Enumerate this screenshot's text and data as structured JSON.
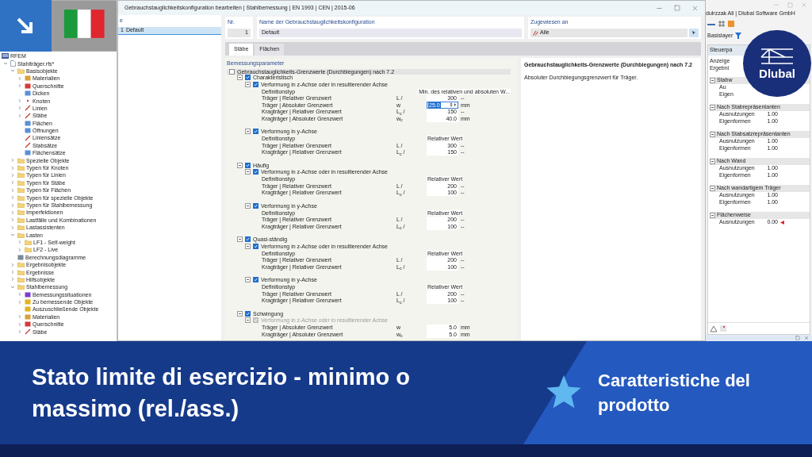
{
  "navigator": {
    "title": "RFEM",
    "items": [
      {
        "label": "Stahlträger.rfs*",
        "kind": "file",
        "expanded": true,
        "children": [
          {
            "label": "Basisobjekte",
            "kind": "folder",
            "expanded": true,
            "children": [
              {
                "label": "Materialien",
                "kind": "material",
                "expanded": false
              },
              {
                "label": "Querschnitte",
                "kind": "section",
                "expanded": false
              },
              {
                "label": "Dicken",
                "kind": "thickness"
              },
              {
                "label": "Knoten",
                "kind": "node",
                "expanded": false
              },
              {
                "label": "Linien",
                "kind": "line",
                "expanded": false
              },
              {
                "label": "Stäbe",
                "kind": "line",
                "expanded": false
              },
              {
                "label": "Flächen",
                "kind": "thickness"
              },
              {
                "label": "Öffnungen",
                "kind": "thickness"
              },
              {
                "label": "Liniensätze",
                "kind": "line"
              },
              {
                "label": "Stabsätze",
                "kind": "line"
              },
              {
                "label": "Flächensätze",
                "kind": "thickness"
              }
            ]
          },
          {
            "label": "Spezielle Objekte",
            "kind": "folder",
            "expanded": false
          },
          {
            "label": "Typen für Knoten",
            "kind": "folder",
            "expanded": false
          },
          {
            "label": "Typen für Linien",
            "kind": "folder",
            "expanded": false
          },
          {
            "label": "Typen für Stäbe",
            "kind": "folder",
            "expanded": false
          },
          {
            "label": "Typen für Flächen",
            "kind": "folder",
            "expanded": false
          },
          {
            "label": "Typen für spezielle Objekte",
            "kind": "folder",
            "expanded": false
          },
          {
            "label": "Typen für Stahlbemessung",
            "kind": "folder",
            "expanded": false
          },
          {
            "label": "Imperfektionen",
            "kind": "folder",
            "expanded": false
          },
          {
            "label": "Lastfälle und Kombinationen",
            "kind": "folder",
            "expanded": false
          },
          {
            "label": "Lastassistenten",
            "kind": "folder",
            "expanded": false
          },
          {
            "label": "Lasten",
            "kind": "folder",
            "expanded": true,
            "children": [
              {
                "label": "LF1 - Self-weight",
                "kind": "folder",
                "expanded": false
              },
              {
                "label": "LF2 - Live",
                "kind": "folder",
                "expanded": false
              }
            ]
          },
          {
            "label": "Berechnungsdiagramme",
            "kind": "diagram"
          },
          {
            "label": "Ergebnisobjekte",
            "kind": "folder",
            "expanded": false
          },
          {
            "label": "Ergebnisse",
            "kind": "folder",
            "expanded": false
          },
          {
            "label": "Hilfsobjekte",
            "kind": "folder",
            "expanded": false
          },
          {
            "label": "Stahlbemessung",
            "kind": "folder",
            "expanded": true,
            "children": [
              {
                "label": "Bemessungssituationen",
                "kind": "situation",
                "expanded": false
              },
              {
                "label": "Zu bemessende Objekte",
                "kind": "objects",
                "expanded": false
              },
              {
                "label": "Auszuschließende Objekte",
                "kind": "objects"
              },
              {
                "label": "Materialien",
                "kind": "material",
                "expanded": false
              },
              {
                "label": "Querschnitte",
                "kind": "section",
                "expanded": false
              },
              {
                "label": "Stäbe",
                "kind": "line",
                "expanded": false
              }
            ]
          }
        ]
      }
    ]
  },
  "dialog": {
    "title": "Gebrauchstauglichkeitskonfiguration bearbeiten | Stahlbemessung | EN 1993 | CEN | 2015-06",
    "list": {
      "header": "e",
      "items": [
        {
          "no": "1",
          "name": "Default",
          "selected": true
        }
      ]
    },
    "number": {
      "label": "Nr.",
      "value": "1"
    },
    "name": {
      "label": "Name der Gebrauchstauglichkeitskonfiguration",
      "value": "Default"
    },
    "assigned": {
      "label": "Zugewiesen an",
      "value": "Alle"
    },
    "tabs": [
      {
        "label": "Stäbe",
        "selected": true
      },
      {
        "label": "Flächen",
        "selected": false
      }
    ],
    "params": {
      "title": "Bemessungsparameter",
      "root": {
        "label": "Gebrauchstauglichkeits-Grenzwerte (Durchbiegungen) nach 7.2",
        "checked": false
      },
      "groups": [
        {
          "label": "Charakteristisch",
          "checked": true,
          "sections": [
            {
              "label": "Verformung in z-Achse oder in resultierender Achse",
              "checked": true,
              "disabled": false,
              "rows": [
                {
                  "kind": "type",
                  "label": "Definitionstyp",
                  "value": "Min. des relativen und absoluten W..."
                },
                {
                  "kind": "value",
                  "label": "Träger | Relativer Grenzwert",
                  "symbol": "L /",
                  "value": "300",
                  "unit": "--",
                  "focused": false
                },
                {
                  "kind": "value",
                  "label": "Träger | Absoluter Grenzwert",
                  "symbol": "w",
                  "value": "25.0",
                  "unit": "mm",
                  "focused": true
                },
                {
                  "kind": "value",
                  "label": "Kragträger | Relativer Grenzwert",
                  "symbol": "L$_{c}$ /",
                  "value": "150",
                  "unit": "--",
                  "focused": false
                },
                {
                  "kind": "value",
                  "label": "Kragträger | Absoluter Grenzwert",
                  "symbol": "w$_{c}$",
                  "value": "40.0",
                  "unit": "mm",
                  "focused": false
                }
              ]
            },
            {
              "label": "Verformung in y-Achse",
              "checked": true,
              "disabled": false,
              "rows": [
                {
                  "kind": "type",
                  "label": "Definitionstyp",
                  "value": "Relativer Wert"
                },
                {
                  "kind": "value",
                  "label": "Träger | Relativer Grenzwert",
                  "symbol": "L /",
                  "value": "300",
                  "unit": "--",
                  "focused": false
                },
                {
                  "kind": "value",
                  "label": "Kragträger | Relativer Grenzwert",
                  "symbol": "L$_{c}$ /",
                  "value": "150",
                  "unit": "--",
                  "focused": false
                }
              ]
            }
          ]
        },
        {
          "label": "Häufig",
          "checked": true,
          "sections": [
            {
              "label": "Verformung in z-Achse oder in resultierender Achse",
              "checked": true,
              "disabled": false,
              "rows": [
                {
                  "kind": "type",
                  "label": "Definitionstyp",
                  "value": "Relativer Wert"
                },
                {
                  "kind": "value",
                  "label": "Träger | Relativer Grenzwert",
                  "symbol": "L /",
                  "value": "200",
                  "unit": "--",
                  "focused": false
                },
                {
                  "kind": "value",
                  "label": "Kragträger | Relativer Grenzwert",
                  "symbol": "L$_{c}$ /",
                  "value": "100",
                  "unit": "--",
                  "focused": false
                }
              ]
            },
            {
              "label": "Verformung in y-Achse",
              "checked": true,
              "disabled": false,
              "rows": [
                {
                  "kind": "type",
                  "label": "Definitionstyp",
                  "value": "Relativer Wert"
                },
                {
                  "kind": "value",
                  "label": "Träger | Relativer Grenzwert",
                  "symbol": "L /",
                  "value": "200",
                  "unit": "--",
                  "focused": false
                },
                {
                  "kind": "value",
                  "label": "Kragträger | Relativer Grenzwert",
                  "symbol": "L$_{c}$ /",
                  "value": "100",
                  "unit": "--",
                  "focused": false
                }
              ]
            }
          ]
        },
        {
          "label": "Quasi-ständig",
          "checked": true,
          "sections": [
            {
              "label": "Verformung in z-Achse oder in resultierender Achse",
              "checked": true,
              "disabled": false,
              "rows": [
                {
                  "kind": "type",
                  "label": "Definitionstyp",
                  "value": "Relativer Wert"
                },
                {
                  "kind": "value",
                  "label": "Träger | Relativer Grenzwert",
                  "symbol": "L /",
                  "value": "200",
                  "unit": "--",
                  "focused": false
                },
                {
                  "kind": "value",
                  "label": "Kragträger | Relativer Grenzwert",
                  "symbol": "L$_{c}$ /",
                  "value": "100",
                  "unit": "--",
                  "focused": false
                }
              ]
            },
            {
              "label": "Verformung in y-Achse",
              "checked": true,
              "disabled": false,
              "rows": [
                {
                  "kind": "type",
                  "label": "Definitionstyp",
                  "value": "Relativer Wert"
                },
                {
                  "kind": "value",
                  "label": "Träger | Relativer Grenzwert",
                  "symbol": "L /",
                  "value": "200",
                  "unit": "--",
                  "focused": false
                },
                {
                  "kind": "value",
                  "label": "Kragträger | Relativer Grenzwert",
                  "symbol": "L$_{c}$ /",
                  "value": "100",
                  "unit": "--",
                  "focused": false
                }
              ]
            }
          ]
        },
        {
          "label": "Schwingung",
          "checked": true,
          "sections": [
            {
              "label": "Verformung in z-Achse oder in resultierender Achse",
              "checked": true,
              "disabled": true,
              "rows": [
                {
                  "kind": "value",
                  "label": "Träger | Absoluter Grenzwert",
                  "symbol": "w",
                  "value": "5.0",
                  "unit": "mm",
                  "focused": false
                },
                {
                  "kind": "value",
                  "label": "Kragträger | Absoluter Grenzwert",
                  "symbol": "w$_{c}$",
                  "value": "5.0",
                  "unit": "mm",
                  "focused": false
                }
              ]
            }
          ]
        }
      ]
    },
    "info": {
      "title": "Gebrauchstauglichkeits-Grenzwerte (Durchbiegungen) nach 7.2",
      "text": "Absoluter Durchbiegungsgrenzwert für Träger."
    }
  },
  "side_app": {
    "title": "dulrzzak Ali | Dlubal Software GmbH",
    "layer": "Basislayer",
    "panel_title": "Steuerpa",
    "display": [
      "Anzeige",
      "Ergebni"
    ],
    "groups": [
      {
        "label": "Stabw",
        "rows": [
          {
            "label": "Au",
            "flagged": false
          },
          {
            "label": "Eigen",
            "flagged": false
          }
        ]
      },
      {
        "label": "Nach Stabrepräsentanten",
        "rows": [
          {
            "label": "Ausnutzungen",
            "value": "1.00",
            "flagged": false
          },
          {
            "label": "Eigenformen",
            "value": "1.00",
            "flagged": false
          }
        ]
      },
      {
        "label": "Nach Stabsatzrepräsentanten",
        "rows": [
          {
            "label": "Ausnutzungen",
            "value": "1.00",
            "flagged": false
          },
          {
            "label": "Eigenformen",
            "value": "1.00",
            "flagged": false
          }
        ]
      },
      {
        "label": "Nach Wand",
        "rows": [
          {
            "label": "Ausnutzungen",
            "value": "1.00",
            "flagged": false
          },
          {
            "label": "Eigenformen",
            "value": "1.00",
            "flagged": false
          }
        ]
      },
      {
        "label": "Nach wandartigem Träger",
        "rows": [
          {
            "label": "Ausnutzungen",
            "value": "1.00",
            "flagged": false
          },
          {
            "label": "Eigenformen",
            "value": "1.00",
            "flagged": false
          }
        ]
      },
      {
        "label": "Flächenweise",
        "rows": [
          {
            "label": "Ausnutzungen",
            "value": "0.00",
            "flagged": true
          }
        ]
      }
    ]
  },
  "logo": {
    "text": "Dlubal"
  },
  "banner": {
    "title": "Stato limite di esercizio - minimo o massimo (rel./ass.)",
    "subtitle": "Caratteristiche del prodotto"
  }
}
